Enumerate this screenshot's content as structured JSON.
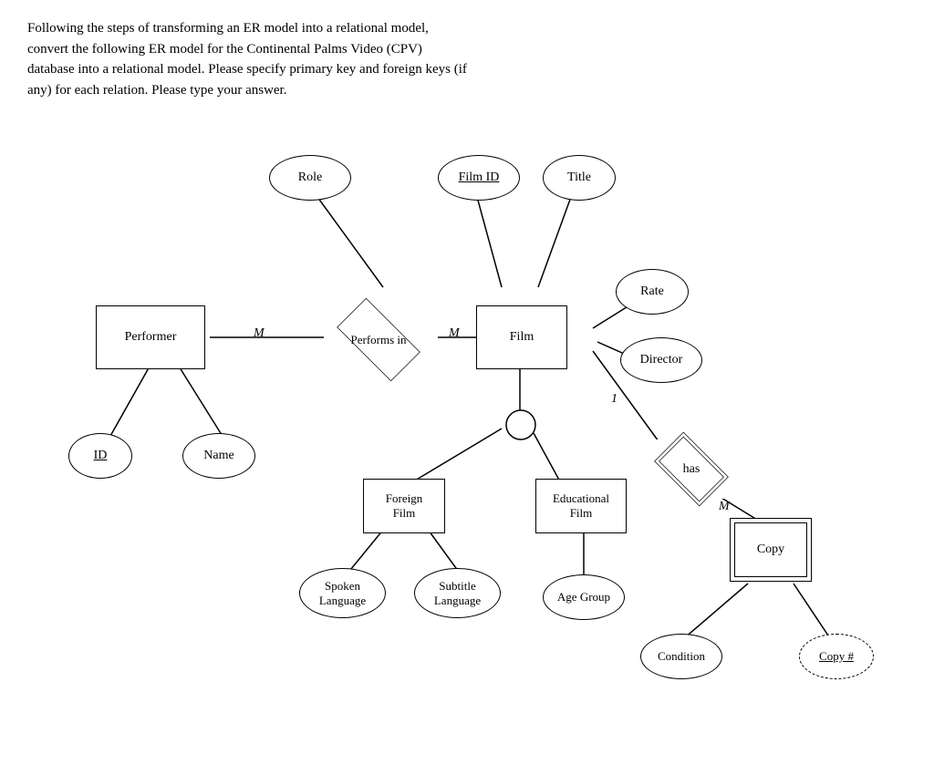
{
  "description": {
    "line1": "Following the steps of transforming an ER model into a relational model,",
    "line2": "convert the following ER model for the Continental Palms Video (CPV)",
    "line3": "database into a relational model. Please specify primary key and foreign keys (if",
    "line4": "any) for each relation. Please type your answer."
  },
  "nodes": {
    "role": "Role",
    "filmID": "Film ID",
    "title": "Title",
    "rate": "Rate",
    "director": "Director",
    "performer": "Performer",
    "performsIn": "Performs in",
    "film": "Film",
    "id": "ID",
    "name": "Name",
    "foreignFilm": "Foreign\nFilm",
    "educationalFilm": "Educational\nFilm",
    "spokenLanguage": "Spoken\nLanguage",
    "subtitleLanguage": "Subtitle\nLanguage",
    "ageGroup": "Age Group",
    "has": "has",
    "copy": "Copy",
    "condition": "Condition",
    "copyHash": "Copy #",
    "labelM1": "M",
    "labelM2": "M",
    "label1": "1",
    "labelM3": "M"
  }
}
